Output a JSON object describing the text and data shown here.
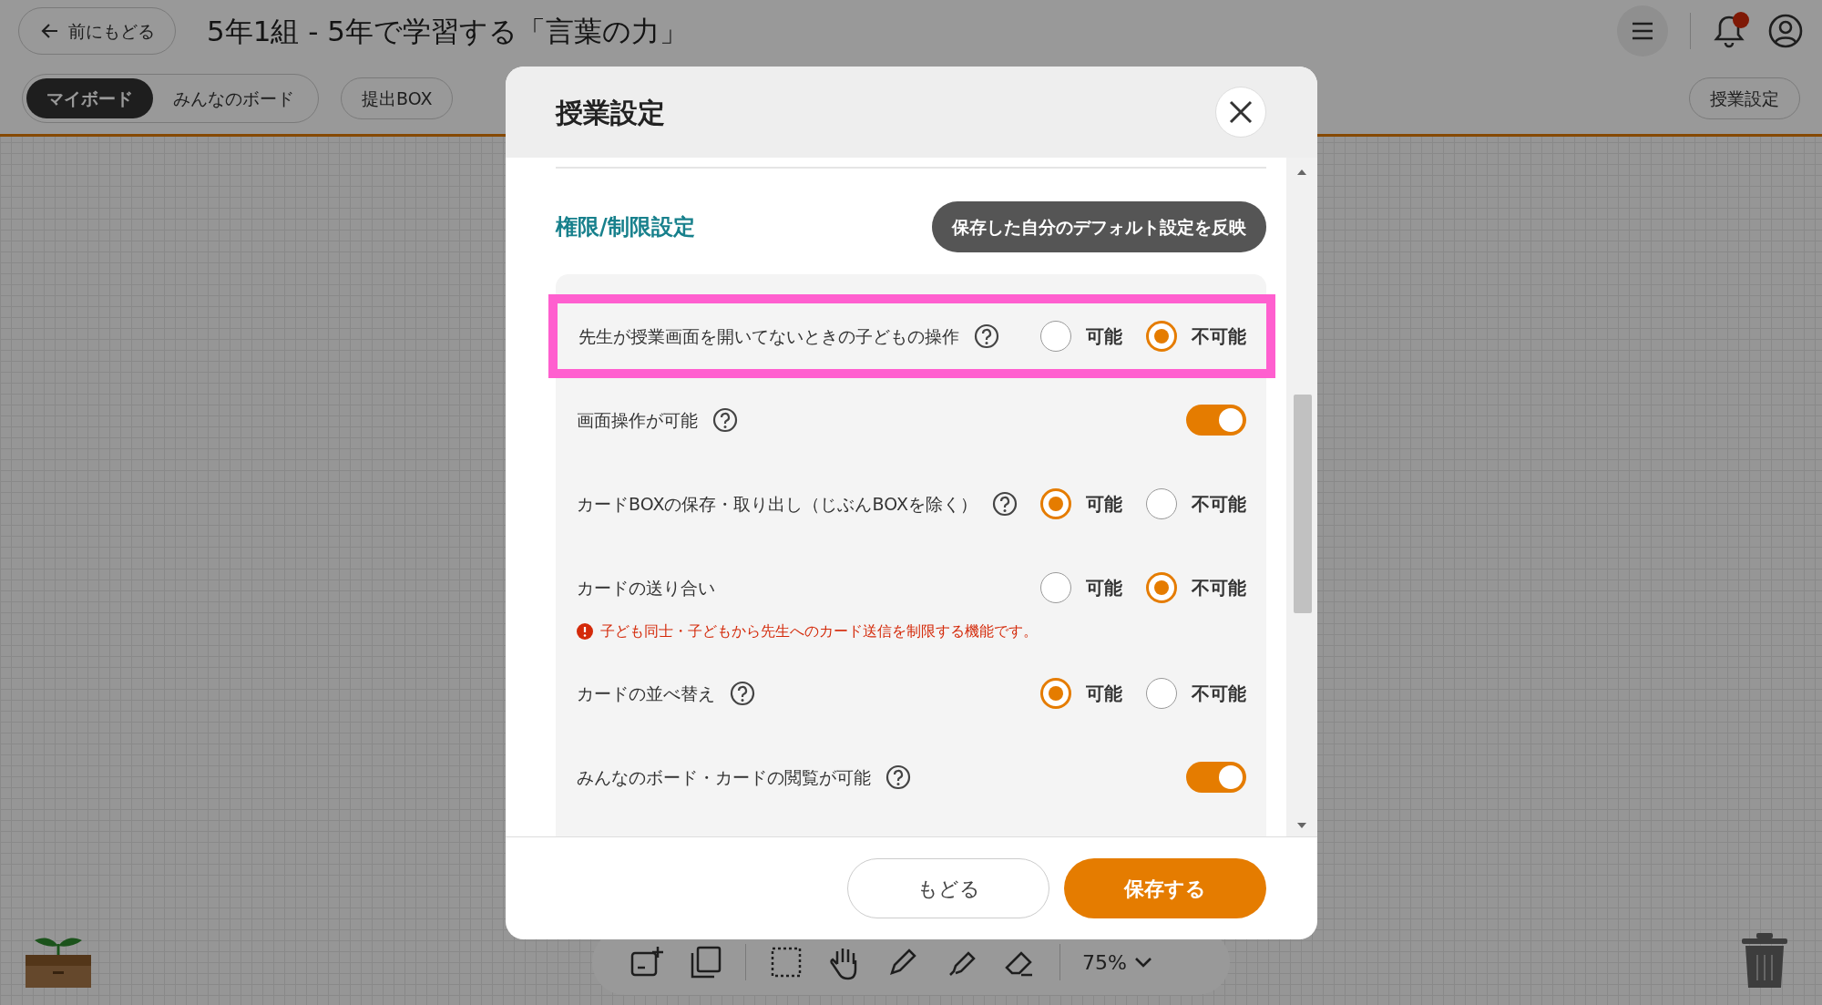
{
  "header": {
    "back_button": "前にもどる",
    "title": "5年1組 - 5年で学習する「言葉の力」",
    "notification_dot": true
  },
  "tabs": [
    {
      "label": "マイボード",
      "selected": true
    },
    {
      "label": "みんなのボード",
      "selected": false
    }
  ],
  "submit_box_button": "提出BOX",
  "settings_button": "授業設定",
  "toolbar": {
    "zoom": "75%"
  },
  "dialog": {
    "title": "授業設定",
    "section_title": "権限/制限設定",
    "apply_default_button": "保存した自分のデフォルト設定を反映",
    "settings": [
      {
        "kind": "radio",
        "label": "先生が授業画面を開いてないときの子どもの操作",
        "help": true,
        "highlighted": true,
        "options": [
          {
            "label": "可能",
            "selected": false
          },
          {
            "label": "不可能",
            "selected": true
          }
        ]
      },
      {
        "kind": "toggle",
        "label": "画面操作が可能",
        "help": true,
        "highlighted": false,
        "on": true
      },
      {
        "kind": "radio",
        "label": "カードBOXの保存・取り出し（じぶんBOXを除く）",
        "help": true,
        "highlighted": false,
        "options": [
          {
            "label": "可能",
            "selected": true
          },
          {
            "label": "不可能",
            "selected": false
          }
        ]
      },
      {
        "kind": "radio",
        "label": "カードの送り合い",
        "help": false,
        "highlighted": false,
        "warning": "子ども同士・子どもから先生へのカード送信を制限する機能です。",
        "options": [
          {
            "label": "可能",
            "selected": false
          },
          {
            "label": "不可能",
            "selected": true
          }
        ]
      },
      {
        "kind": "radio",
        "label": "カードの並べ替え",
        "help": true,
        "highlighted": false,
        "options": [
          {
            "label": "可能",
            "selected": true
          },
          {
            "label": "不可能",
            "selected": false
          }
        ]
      },
      {
        "kind": "toggle",
        "label": "みんなのボード・カードの閲覧が可能",
        "help": true,
        "highlighted": false,
        "on": true
      }
    ],
    "cancel_button": "もどる",
    "save_button": "保存する"
  }
}
